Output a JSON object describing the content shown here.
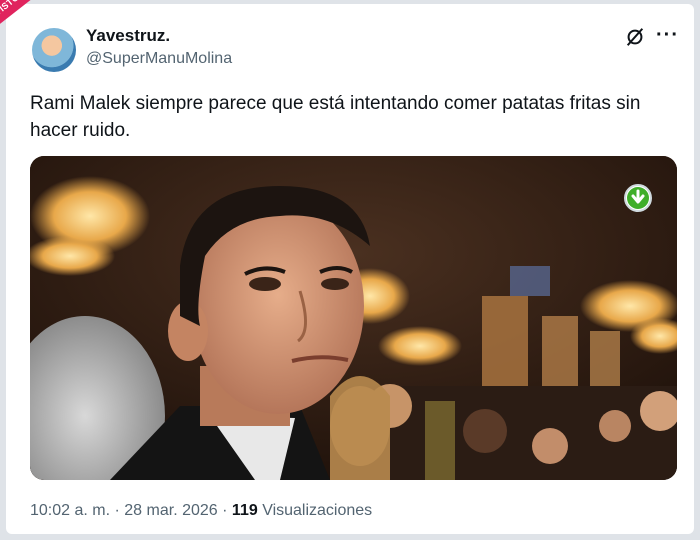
{
  "author": {
    "name": "Yavestruz.",
    "handle": "@SuperManuMolina"
  },
  "watermark_text": "VISTOENLASREDES",
  "tweet": {
    "text": "Rami Malek siempre parece que está intentando comer patatas fritas sin hacer ruido."
  },
  "meta": {
    "time": "10:02 a. m.",
    "separator": "·",
    "date": "28 mar. 2026",
    "views_count": "119",
    "views_label": "Visualizaciones"
  },
  "icons": {
    "grok": "grok-slash-icon",
    "more": "more-options-icon",
    "download": "download-arrow-icon"
  },
  "colors": {
    "download_green": "#3fae2a",
    "watermark": "#e0245e"
  }
}
